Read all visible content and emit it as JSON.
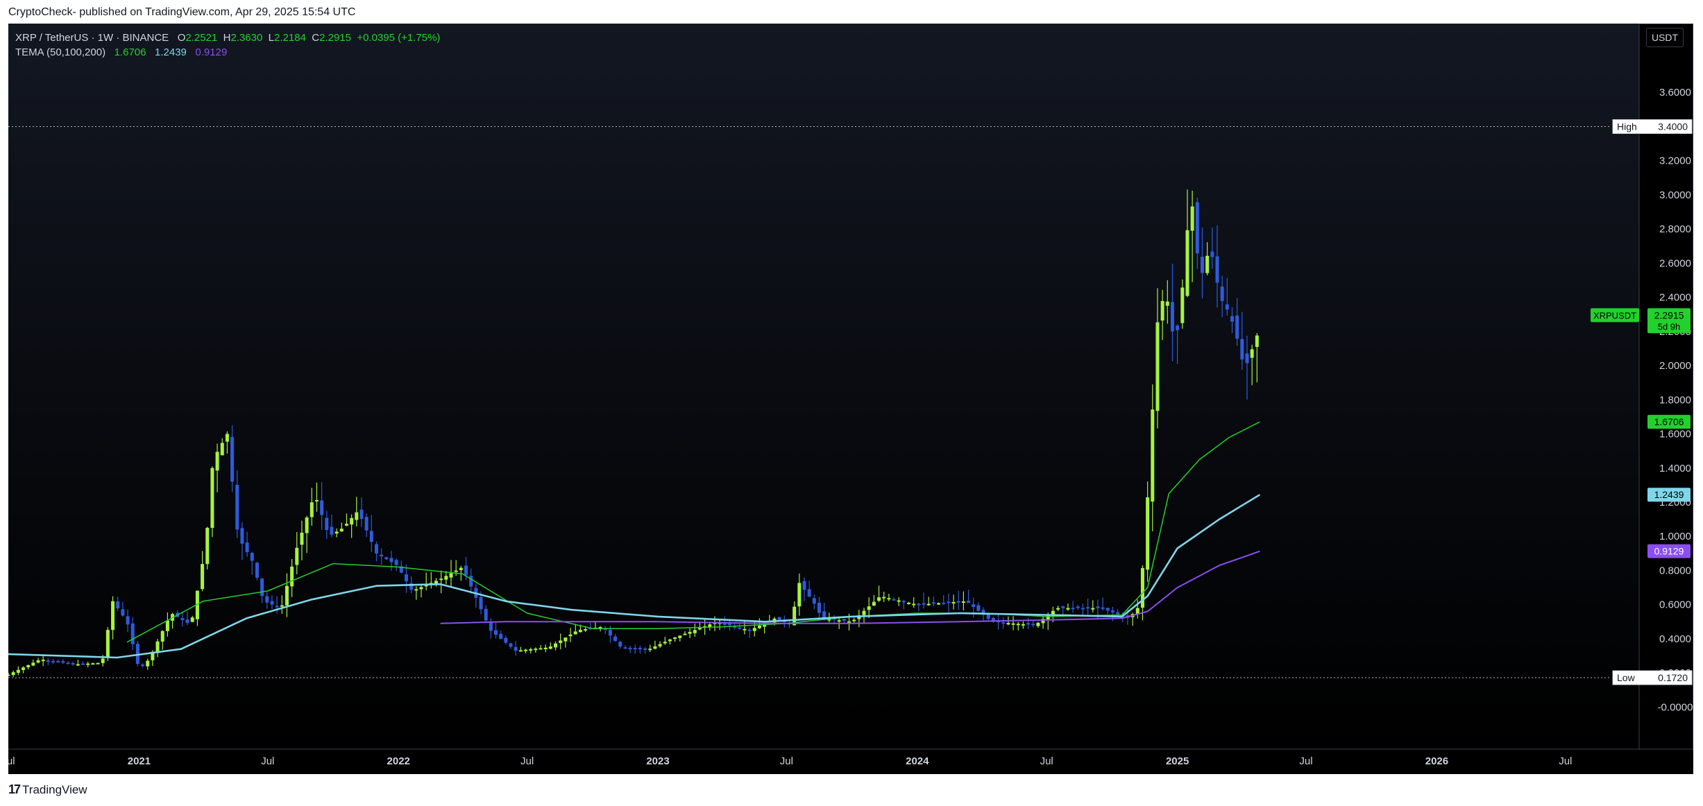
{
  "header": {
    "published": "CryptoCheck- published on TradingView.com, Apr 29, 2025 15:54 UTC"
  },
  "legend": {
    "symbol": "XRP / TetherUS · 1W · BINANCE",
    "o_label": "O",
    "o_value": "2.2521",
    "h_label": "H",
    "h_value": "2.3630",
    "l_label": "L",
    "l_value": "2.2184",
    "c_label": "C",
    "c_value": "2.2915",
    "change": "+0.0395 (+1.75%)",
    "indicator": "TEMA (50,100,200)",
    "ind_values": [
      "1.6706",
      "1.2439",
      "0.9129"
    ]
  },
  "unit": "USDT",
  "footer": {
    "logo_mark": "17",
    "logo_text": "TradingView"
  },
  "colors": {
    "up": "#a6f33d",
    "down": "#2e5bdc",
    "tema1": "#22d12c",
    "tema2": "#7fd6ea",
    "tema3": "#8a4ff0",
    "background": "#000000",
    "axis_text": "#d1d4dc"
  },
  "chart_data": {
    "type": "candlestick",
    "symbol": "XRPUSDT",
    "interval": "1W",
    "ylim": [
      -0.1,
      3.8
    ],
    "yticks": [
      "3.6000",
      "3.2000",
      "3.0000",
      "2.8000",
      "2.6000",
      "2.4000",
      "2.2000",
      "2.0000",
      "1.8000",
      "1.6000",
      "1.4000",
      "1.2000",
      "1.0000",
      "0.8000",
      "0.6000",
      "0.4000",
      "0.2000",
      "-0.0000"
    ],
    "xticks": [
      "Jul",
      "2021",
      "Jul",
      "2022",
      "Jul",
      "2023",
      "Jul",
      "2024",
      "Jul",
      "2025",
      "Jul",
      "2026",
      "Jul"
    ],
    "xtick_dates": [
      "2020-07-01",
      "2021-01-01",
      "2021-07-01",
      "2022-01-01",
      "2022-07-01",
      "2023-01-01",
      "2023-07-01",
      "2024-01-01",
      "2024-07-01",
      "2025-01-01",
      "2025-07-01",
      "2026-01-01",
      "2026-07-01"
    ],
    "x_range": [
      "2020-07-01",
      "2026-10-01"
    ],
    "high_line": {
      "label": "High",
      "value": "3.4000"
    },
    "low_line": {
      "label": "Low",
      "value": "0.1720"
    },
    "price_tag": {
      "label": "XRPUSDT",
      "value": "2.2915",
      "countdown": "5d 9h"
    },
    "ind_tags": [
      "1.6706",
      "1.2439",
      "0.9129"
    ],
    "price_path": [
      [
        "2020-07-01",
        0.19
      ],
      [
        "2020-08-15",
        0.28
      ],
      [
        "2020-10-01",
        0.25
      ],
      [
        "2020-11-10",
        0.26
      ],
      [
        "2020-11-25",
        0.62
      ],
      [
        "2020-12-15",
        0.5
      ],
      [
        "2021-01-01",
        0.22
      ],
      [
        "2021-01-15",
        0.28
      ],
      [
        "2021-02-15",
        0.55
      ],
      [
        "2021-03-15",
        0.48
      ],
      [
        "2021-04-05",
        0.95
      ],
      [
        "2021-04-15",
        1.45
      ],
      [
        "2021-05-05",
        1.6
      ],
      [
        "2021-05-20",
        1.0
      ],
      [
        "2021-06-10",
        0.85
      ],
      [
        "2021-06-25",
        0.62
      ],
      [
        "2021-07-20",
        0.58
      ],
      [
        "2021-08-10",
        0.92
      ],
      [
        "2021-09-05",
        1.25
      ],
      [
        "2021-09-25",
        1.0
      ],
      [
        "2021-10-15",
        1.05
      ],
      [
        "2021-11-05",
        1.15
      ],
      [
        "2021-12-01",
        0.9
      ],
      [
        "2021-12-30",
        0.83
      ],
      [
        "2022-01-20",
        0.68
      ],
      [
        "2022-03-01",
        0.75
      ],
      [
        "2022-04-01",
        0.82
      ],
      [
        "2022-05-10",
        0.45
      ],
      [
        "2022-06-15",
        0.33
      ],
      [
        "2022-08-01",
        0.35
      ],
      [
        "2022-09-10",
        0.45
      ],
      [
        "2022-10-15",
        0.47
      ],
      [
        "2022-11-10",
        0.35
      ],
      [
        "2022-12-20",
        0.34
      ],
      [
        "2023-01-20",
        0.4
      ],
      [
        "2023-03-25",
        0.5
      ],
      [
        "2023-05-10",
        0.45
      ],
      [
        "2023-06-15",
        0.52
      ],
      [
        "2023-07-10",
        0.48
      ],
      [
        "2023-07-15",
        0.75
      ],
      [
        "2023-08-10",
        0.6
      ],
      [
        "2023-08-20",
        0.52
      ],
      [
        "2023-10-01",
        0.5
      ],
      [
        "2023-11-10",
        0.65
      ],
      [
        "2024-01-01",
        0.6
      ],
      [
        "2024-03-10",
        0.62
      ],
      [
        "2024-04-15",
        0.5
      ],
      [
        "2024-06-15",
        0.48
      ],
      [
        "2024-07-15",
        0.58
      ],
      [
        "2024-09-15",
        0.58
      ],
      [
        "2024-10-25",
        0.52
      ],
      [
        "2024-11-10",
        0.6
      ],
      [
        "2024-11-17",
        1.1
      ],
      [
        "2024-11-24",
        1.4
      ],
      [
        "2024-12-01",
        2.2
      ],
      [
        "2024-12-15",
        2.45
      ],
      [
        "2024-12-29",
        2.1
      ],
      [
        "2025-01-12",
        2.6
      ],
      [
        "2025-01-19",
        3.05
      ],
      [
        "2025-02-02",
        2.5
      ],
      [
        "2025-02-16",
        2.7
      ],
      [
        "2025-03-02",
        2.4
      ],
      [
        "2025-03-16",
        2.3
      ],
      [
        "2025-03-30",
        2.1
      ],
      [
        "2025-04-06",
        1.95
      ],
      [
        "2025-04-13",
        2.1
      ],
      [
        "2025-04-20",
        2.09
      ],
      [
        "2025-04-27",
        2.2915
      ]
    ],
    "tema_series": [
      {
        "name": "TEMA 50",
        "points": [
          [
            "2020-12-15",
            0.38
          ],
          [
            "2021-04-01",
            0.62
          ],
          [
            "2021-07-01",
            0.68
          ],
          [
            "2021-10-01",
            0.84
          ],
          [
            "2022-01-01",
            0.82
          ],
          [
            "2022-04-01",
            0.78
          ],
          [
            "2022-07-01",
            0.55
          ],
          [
            "2022-10-01",
            0.46
          ],
          [
            "2023-01-01",
            0.46
          ],
          [
            "2023-04-01",
            0.47
          ],
          [
            "2023-07-01",
            0.49
          ],
          [
            "2023-10-01",
            0.53
          ],
          [
            "2024-01-01",
            0.55
          ],
          [
            "2024-04-01",
            0.55
          ],
          [
            "2024-07-01",
            0.53
          ],
          [
            "2024-10-15",
            0.54
          ],
          [
            "2024-11-20",
            0.7
          ],
          [
            "2024-12-20",
            1.25
          ],
          [
            "2025-02-01",
            1.45
          ],
          [
            "2025-03-15",
            1.58
          ],
          [
            "2025-04-27",
            1.6706
          ]
        ]
      },
      {
        "name": "TEMA 100",
        "points": [
          [
            "2020-07-01",
            0.31
          ],
          [
            "2020-12-01",
            0.29
          ],
          [
            "2021-03-01",
            0.34
          ],
          [
            "2021-06-01",
            0.52
          ],
          [
            "2021-09-01",
            0.63
          ],
          [
            "2021-12-01",
            0.71
          ],
          [
            "2022-03-01",
            0.72
          ],
          [
            "2022-06-01",
            0.62
          ],
          [
            "2022-09-01",
            0.57
          ],
          [
            "2023-01-01",
            0.53
          ],
          [
            "2023-06-01",
            0.5
          ],
          [
            "2023-10-01",
            0.53
          ],
          [
            "2024-03-01",
            0.55
          ],
          [
            "2024-07-01",
            0.54
          ],
          [
            "2024-10-15",
            0.53
          ],
          [
            "2024-11-20",
            0.65
          ],
          [
            "2025-01-01",
            0.93
          ],
          [
            "2025-03-01",
            1.1
          ],
          [
            "2025-04-27",
            1.2439
          ]
        ]
      },
      {
        "name": "TEMA 200",
        "points": [
          [
            "2022-03-01",
            0.49
          ],
          [
            "2022-06-01",
            0.5
          ],
          [
            "2022-09-01",
            0.5
          ],
          [
            "2023-01-01",
            0.5
          ],
          [
            "2023-06-01",
            0.49
          ],
          [
            "2023-10-01",
            0.49
          ],
          [
            "2024-03-01",
            0.5
          ],
          [
            "2024-07-01",
            0.51
          ],
          [
            "2024-10-15",
            0.52
          ],
          [
            "2024-11-20",
            0.56
          ],
          [
            "2025-01-01",
            0.7
          ],
          [
            "2025-03-01",
            0.83
          ],
          [
            "2025-04-27",
            0.9129
          ]
        ]
      }
    ]
  }
}
